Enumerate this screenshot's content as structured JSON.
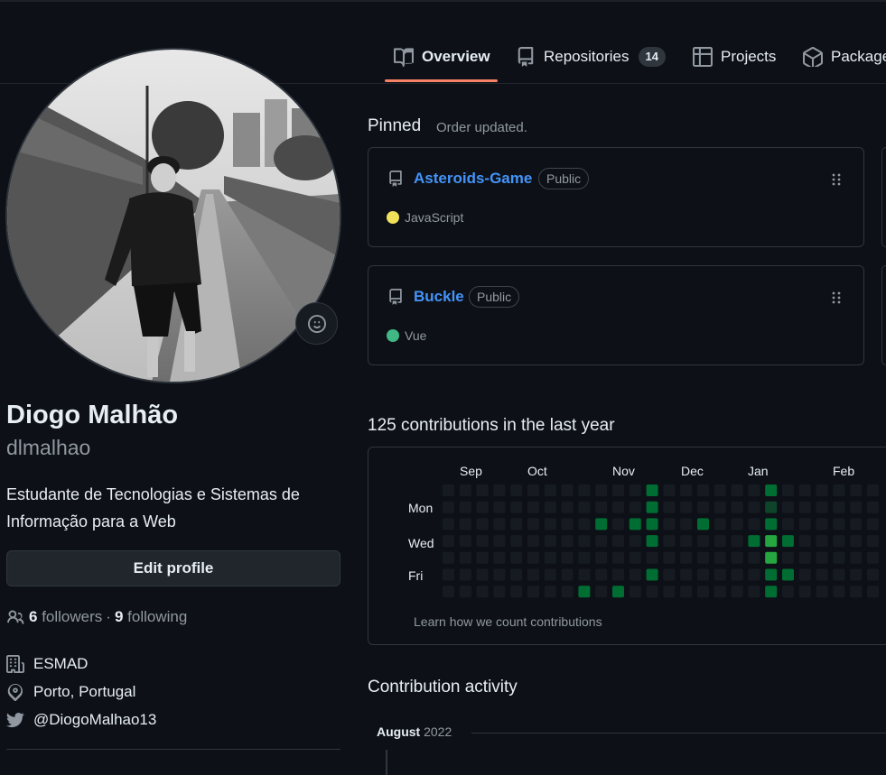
{
  "nav": {
    "tabs": [
      {
        "label": "Overview",
        "icon": "book-icon"
      },
      {
        "label": "Repositories",
        "icon": "repo-icon",
        "count": "14"
      },
      {
        "label": "Projects",
        "icon": "table-icon"
      },
      {
        "label": "Packages",
        "icon": "package-icon"
      }
    ],
    "active_tab": "Overview"
  },
  "profile": {
    "name": "Diogo Malhão",
    "login": "dlmalhao",
    "bio": "Estudante de Tecnologias e Sistemas de Informação para a Web",
    "edit_label": "Edit profile",
    "followers_count": "6",
    "followers_label": "followers",
    "separator": "·",
    "following_count": "9",
    "following_label": "following",
    "organization": "ESMAD",
    "location": "Porto, Portugal",
    "twitter": "@DiogoMalhao13"
  },
  "pinned": {
    "title": "Pinned",
    "status": "Order updated.",
    "repos": [
      {
        "name": "Asteroids-Game",
        "visibility": "Public",
        "language": "JavaScript",
        "language_color": "#f1e05a"
      },
      {
        "name": "Buckle",
        "visibility": "Public",
        "language": "Vue",
        "language_color": "#41b883"
      }
    ]
  },
  "contributions": {
    "title": "125 contributions in the last year",
    "months": [
      "Sep",
      "Oct",
      "Nov",
      "Dec",
      "Jan",
      "Feb"
    ],
    "days": [
      "Mon",
      "Wed",
      "Fri"
    ],
    "learn_link": "Learn how we count contributions",
    "empty_color": "#161b22",
    "level_colors": [
      "#161b22",
      "#0e4429",
      "#006d32",
      "#26a641"
    ],
    "active_cells": [
      {
        "week": 12,
        "day": 0,
        "level": 2
      },
      {
        "week": 12,
        "day": 1,
        "level": 2
      },
      {
        "week": 9,
        "day": 2,
        "level": 2
      },
      {
        "week": 11,
        "day": 2,
        "level": 2
      },
      {
        "week": 12,
        "day": 2,
        "level": 2
      },
      {
        "week": 15,
        "day": 2,
        "level": 2
      },
      {
        "week": 12,
        "day": 3,
        "level": 2
      },
      {
        "week": 12,
        "day": 5,
        "level": 2
      },
      {
        "week": 8,
        "day": 6,
        "level": 2
      },
      {
        "week": 10,
        "day": 6,
        "level": 2
      },
      {
        "week": 19,
        "day": 0,
        "level": 2
      },
      {
        "week": 19,
        "day": 1,
        "level": 1
      },
      {
        "week": 19,
        "day": 2,
        "level": 2
      },
      {
        "week": 18,
        "day": 3,
        "level": 2
      },
      {
        "week": 19,
        "day": 3,
        "level": 3
      },
      {
        "week": 20,
        "day": 3,
        "level": 2
      },
      {
        "week": 19,
        "day": 4,
        "level": 3
      },
      {
        "week": 19,
        "day": 5,
        "level": 2
      },
      {
        "week": 20,
        "day": 5,
        "level": 2
      },
      {
        "week": 19,
        "day": 6,
        "level": 2
      }
    ]
  },
  "activity": {
    "title": "Contribution activity",
    "month": "August",
    "year": "2022"
  }
}
